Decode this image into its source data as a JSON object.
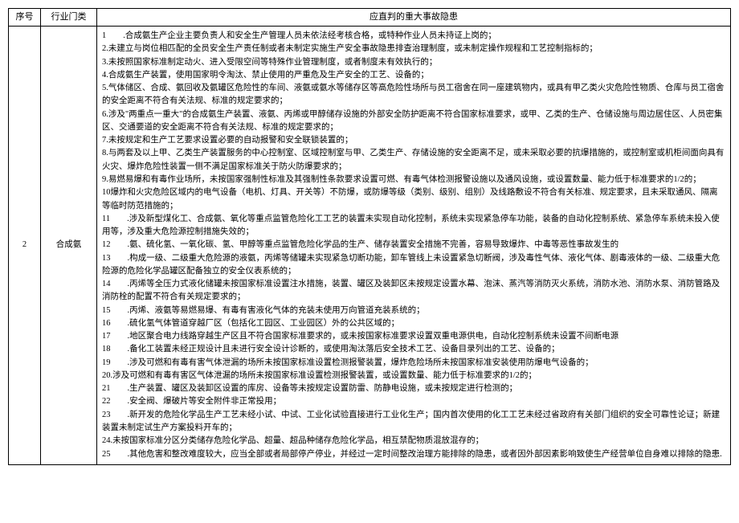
{
  "headers": {
    "seq": "序号",
    "industry": "行业门类",
    "hazard": "应直判的重大事故隐患"
  },
  "row": {
    "seq": "2",
    "industry": "合成氨",
    "items": [
      "1　　.合成氨生产企业主要负责人和安全生产管理人员未依法经考核合格，或特种作业人员未持证上岗的；",
      "2.未建立与岗位相匹配的全员安全生产责任制或者未制定实施生产安全事故隐患排查治理制度，或未制定操作规程和工艺控制指标的；",
      "3.未按照国家标准制定动火、进入受限空间等特殊作业管理制度，或者制度未有效执行的；",
      "4.合成氨生产装置，使用国家明令淘汰、禁止使用的严重危及生产安全的工艺、设备的；",
      "5.气体储区、合成、氨回收及氨罐区危险性的车间、液氨或氨水等储存区等高危险性场所与员工宿舍在同一座建筑物内，或具有甲乙类火灾危险性物质、仓库与员工宿舍的安全距离不符合有关法规、标准的规定要求的；",
      "6.涉及\"两重点一重大\"的合成氨生产装置、液氨、丙烯或甲醇储存设施的外部安全防护距离不符合国家标准要求，或甲、乙类的生产、仓储设施与周边居住区、人员密集区、交通要道的安全距离不符合有关法规、标准的规定要求的；",
      "7.未按规定和生产工艺要求设置必要的自动报警和安全联锁装置的；",
      "8.与两套及以上甲、乙类生产装置服务的中心控制室、区域控制室与甲、乙类生产、存储设施的安全距离不足，或未采取必要的抗爆措施的，或控制室或机柜间面向具有火灾、爆炸危险性装置一侧不满足国家标准关于防火防爆要求的；",
      "9.易燃易爆和有毒作业场所，未按国家强制性标准及其强制性条款要求设置可燃、有毒气体检测报警设施以及通风设施，或设置数量、能力低于标准要求的1/2的；",
      "10爆炸和火灾危险区域内的电气设备（电机、灯具、开关等）不防爆，或防爆等级（类别、级别、组别）及线路敷设不符合有关标准、规定要求，且未采取通风、隔离等临时防范措施的；",
      "11　　.涉及新型煤化工、合成氨、氧化等重点监管危险化工工艺的装置未实现自动化控制，系统未实现紧急停车功能，装备的自动化控制系统、紧急停车系统未投入使用等，涉及重大危险源控制措施失效的；",
      "12　　.氨、硫化氢、一氧化碳、氢、甲醇等重点监管危险化学品的生产、储存装置安全措施不完善，容易导致爆炸、中毒等恶性事故发生的",
      "13　　.构成一级、二级重大危险源的液氨，丙烯等储罐未实现紧急切断功能，卸车管线上未设置紧急切断阀，涉及毒性气体、液化气体、剧毒液体的一级、二级重大危险源的危险化学品罐区配备独立的安全仪表系统的；",
      "14　　.丙烯等全压力式液化储罐未按国家标准设置注水措施，装置、罐区及装卸区未按规定设置水幕、泡沫、蒸汽等消防灭火系统，消防水池、消防水泵、消防管路及消防栓的配置不符合有关规定要求的；",
      "15　　.丙烯、液氨等易燃易爆、有毒有害液化气体的充装未使用万向管道充装系统的；",
      "16　　.硫化氢气体管道穿越厂区（包括化工园区、工业园区）外的公共区域的；",
      "17　　.地区聚合电力线路穿越生产区且不符合国家标准要求的，或未按国家标准要求设置双重电源供电，自动化控制系统未设置不间断电源",
      "18　　.备化工装置未经正规设计且未进行安全设计诊断的，或使用淘汰落后安全技术工艺、设备目录列出的工艺、设备的；",
      "19　　.涉及可燃和有毒有害气体泄漏的场所未按国家标准设置检测报警装置，爆炸危险场所未按国家标准安装使用防爆电气设备的；",
      "20.涉及可燃和有毒有害区气体泄漏的场所未按国家标准设置检测报警装置，或设置数量、能力低于标准要求的1/2的；",
      "21　　.生产装置、罐区及装卸区设置的库房、设备等未按规定设置防雷、防静电设施，或未按规定进行检测的；",
      "22　　.安全阀、爆破片等安全附件非正常投用；",
      "23　　.新开发的危险化学品生产工艺未经小试、中试、工业化试验直接进行工业化生产；国内首次使用的化工工艺未经过省政府有关部门组织的安全可靠性论证；新建装置未制定试生产方案投料开车的；",
      "24.未按国家标准分区分类储存危险化学品、超量、超品种储存危险化学品，相互禁配物质混放混存的；",
      "25　　.其他危害和整改难度较大，应当全部或者局部停产停业，并经过一定时间整改治理方能排除的隐患，或者因外部因素影响致使生产经营单位自身难以排除的隐患."
    ]
  }
}
